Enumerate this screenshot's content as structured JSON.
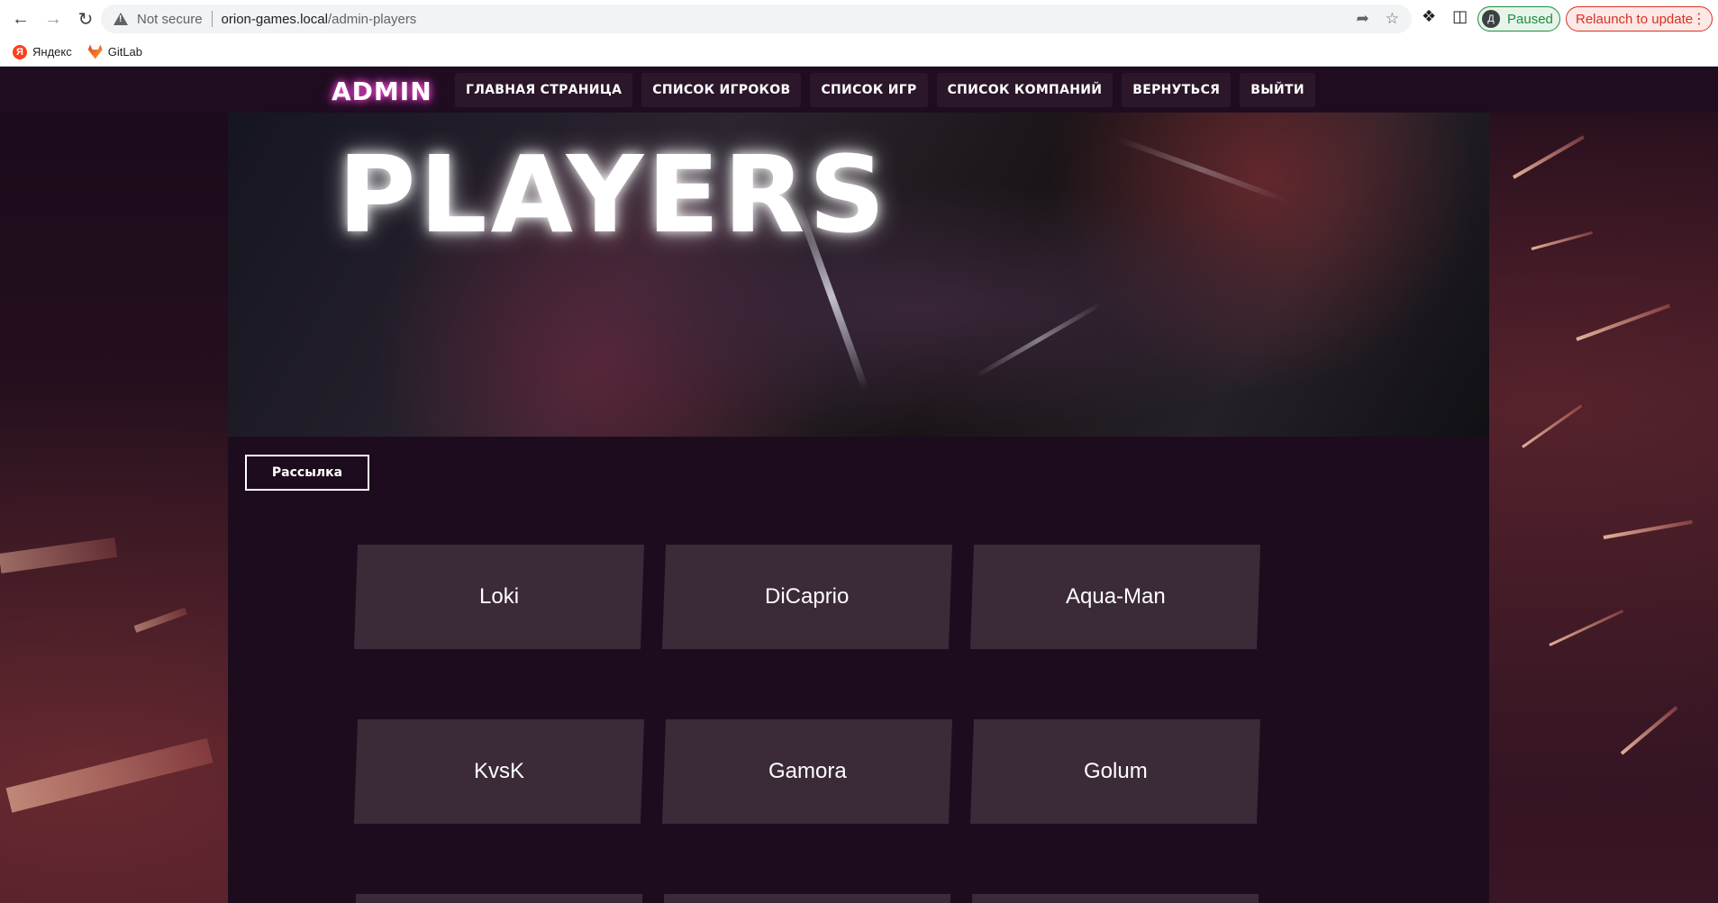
{
  "browser": {
    "security_label": "Not secure",
    "url_host": "orion-games.local",
    "url_path": "/admin-players",
    "profile_initial": "Д",
    "profile_status": "Paused",
    "relaunch_label": "Relaunch to update"
  },
  "bookmarks": [
    {
      "label": "Яндекс",
      "icon": "yandex-icon"
    },
    {
      "label": "GitLab",
      "icon": "gitlab-icon"
    }
  ],
  "site": {
    "logo": "ADMIN",
    "menu": [
      "ГЛАВНАЯ СТРАНИЦА",
      "СПИСОК ИГРОКОВ",
      "СПИСОК ИГР",
      "СПИСОК КОМПАНИЙ",
      "ВЕРНУТЬСЯ",
      "ВЫЙТИ"
    ],
    "hero_title": "PLAYERS",
    "mailing_button": "Рассылка",
    "players": [
      "Loki",
      "DiCaprio",
      "Aqua-Man",
      "KvsK",
      "Gamora",
      "Golum"
    ]
  }
}
